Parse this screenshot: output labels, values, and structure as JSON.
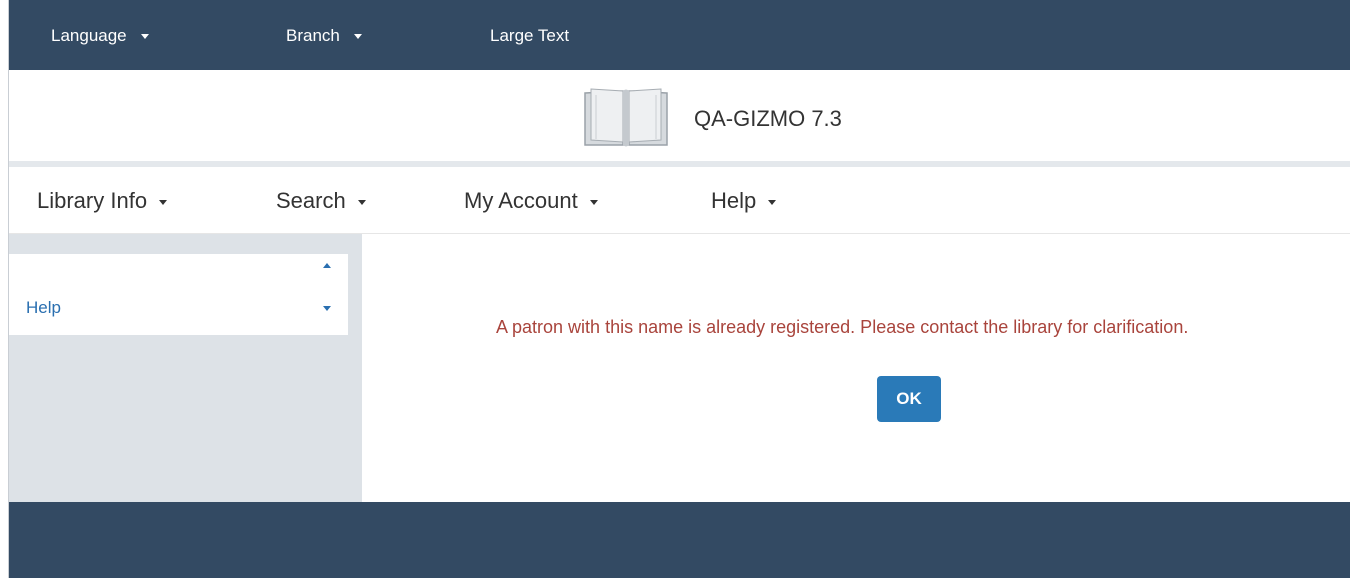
{
  "topbar": {
    "language_label": "Language",
    "branch_label": "Branch",
    "large_text_label": "Large Text"
  },
  "brand": {
    "title": "QA-GIZMO 7.3",
    "logo_icon": "open-book-icon"
  },
  "nav": {
    "items": [
      {
        "label": "Library Info"
      },
      {
        "label": "Search"
      },
      {
        "label": "My Account"
      },
      {
        "label": "Help"
      }
    ]
  },
  "sidebar": {
    "label": "Help"
  },
  "main": {
    "message": "A patron with this name is already registered. Please contact the library for clarification.",
    "ok_label": "OK"
  },
  "colors": {
    "topbar_bg": "#334a63",
    "link": "#2a6fb0",
    "error_text": "#a9443c",
    "button": "#2a7ab8",
    "sidebar_bg": "#dde2e7"
  }
}
